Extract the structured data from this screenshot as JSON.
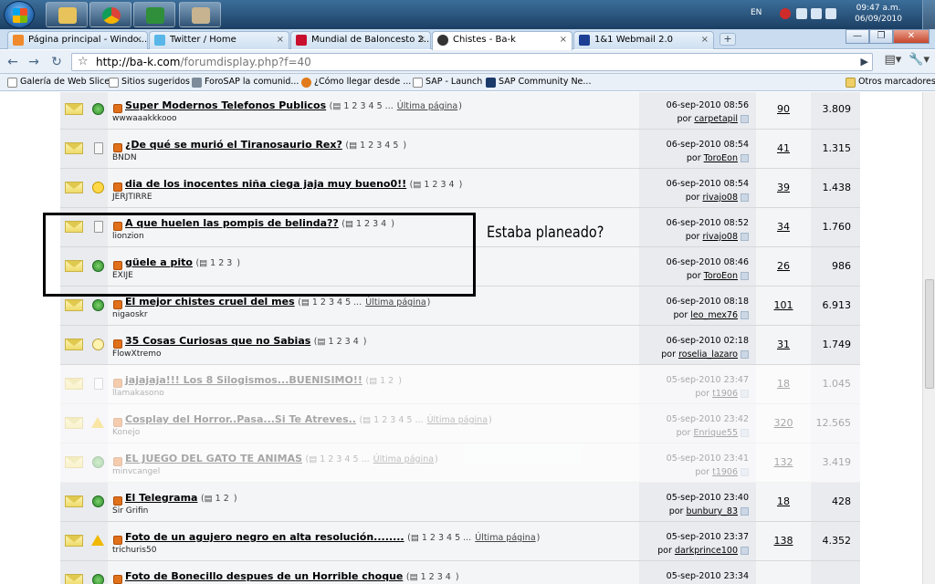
{
  "taskbar": {
    "lang": "EN",
    "time": "09:47 a.m.",
    "date": "06/09/2010"
  },
  "tabs": [
    {
      "label": "Página principal - Windo..."
    },
    {
      "label": "Twitter / Home"
    },
    {
      "label": "Mundial de Baloncesto 2..."
    },
    {
      "label": "Chistes - Ba-k"
    },
    {
      "label": "1&1 Webmail 2.0"
    }
  ],
  "new_tab": "+",
  "window_buttons": {
    "min": "—",
    "max": "❐",
    "close": "✕"
  },
  "address": {
    "host": "http://ba-k.com",
    "path": "/forumdisplay.php?f=40"
  },
  "bookmarks": [
    {
      "label": "Galería de Web Slice"
    },
    {
      "label": "Sitios sugeridos"
    },
    {
      "label": "ForoSAP la comunid..."
    },
    {
      "label": "¿Cómo llegar desde ..."
    },
    {
      "label": "SAP - Launch"
    },
    {
      "label": "SAP Community Ne..."
    },
    {
      "label": "Otros marcadores"
    }
  ],
  "annotation": "Estaba planeado?",
  "threads": [
    {
      "title": "Super Modernos Telefonos Publicos",
      "pages": "1 2 3 4 5 ...",
      "last": "Última página",
      "author": "wwwaaakkkooo",
      "date": "06-sep-2010 08:56",
      "by": "carpetapil",
      "replies": "90",
      "views": "3.809",
      "icon": "globe"
    },
    {
      "title": "¿De qué se murió el Tiranosaurio Rex?",
      "pages": "1 2 3 4 5",
      "last": "",
      "author": "BNDN",
      "date": "06-sep-2010 08:54",
      "by": "ToroEon",
      "replies": "41",
      "views": "1.315",
      "icon": "doc"
    },
    {
      "title": "dia de los inocentes niña ciega jaja muy bueno0!!",
      "pages": "1 2 3 4",
      "last": "",
      "author": "JERJTIRRE",
      "date": "06-sep-2010 08:54",
      "by": "rivajo08",
      "replies": "39",
      "views": "1.438",
      "icon": "smile"
    },
    {
      "title": "A que huelen las pompis de belinda??",
      "pages": "1 2 3 4",
      "last": "",
      "author": "lionzion",
      "date": "06-sep-2010 08:52",
      "by": "rivajo08",
      "replies": "34",
      "views": "1.760",
      "icon": "doc"
    },
    {
      "title": "güele a pito",
      "pages": "1 2 3",
      "last": "",
      "author": "EXIJE",
      "date": "06-sep-2010 08:46",
      "by": "ToroEon",
      "replies": "26",
      "views": "986",
      "icon": "globe"
    },
    {
      "title": "El mejor chistes cruel del mes",
      "pages": "1 2 3 4 5 ...",
      "last": "Última página",
      "author": "nigaoskr",
      "date": "06-sep-2010 08:18",
      "by": "leo_mex76",
      "replies": "101",
      "views": "6.913",
      "icon": "globe"
    },
    {
      "title": "35 Cosas Curiosas que no Sabias",
      "pages": "1 2 3 4",
      "last": "",
      "author": "FlowXtremo",
      "date": "06-sep-2010 02:18",
      "by": "roselia_lazaro",
      "replies": "31",
      "views": "1.749",
      "icon": "bulb"
    },
    {
      "title": "jajajaja!!! Los 8 Silogismos...BUENISIMO!!",
      "pages": "1 2",
      "last": "",
      "author": "llamakasono",
      "date": "05-sep-2010 23:47",
      "by": "t1906",
      "replies": "18",
      "views": "1.045",
      "icon": "doc"
    },
    {
      "title": "Cosplay del Horror..Pasa...Si Te Atreves..",
      "pages": "1 2 3 4 5 ...",
      "last": "Última página",
      "author": "Konejo",
      "date": "05-sep-2010 23:42",
      "by": "Enrique55",
      "replies": "320",
      "views": "12.565",
      "icon": "warn"
    },
    {
      "title": "EL JUEGO DEL GATO TE ANIMAS",
      "pages": "1 2 3 4 5 ...",
      "last": "Última página",
      "author": "minvcangel",
      "date": "05-sep-2010 23:41",
      "by": "t1906",
      "replies": "132",
      "views": "3.419",
      "icon": "globe"
    },
    {
      "title": "El Telegrama",
      "pages": "1 2",
      "last": "",
      "author": "Sir Grifin",
      "date": "05-sep-2010 23:40",
      "by": "bunbury_83",
      "replies": "18",
      "views": "428",
      "icon": "globe"
    },
    {
      "title": "Foto de un agujero negro en alta resolución........",
      "pages": "1 2 3 4 5 ...",
      "last": "Última página",
      "author": "trichuris50",
      "date": "05-sep-2010 23:37",
      "by": "darkprince100",
      "replies": "138",
      "views": "4.352",
      "icon": "warn"
    },
    {
      "title": "Foto de Bonecillo despues de un Horrible choque",
      "pages": "1 2 3 4",
      "last": "",
      "author": "",
      "date": "05-sep-2010 23:34",
      "by": "",
      "replies": "",
      "views": "",
      "icon": "globe"
    }
  ],
  "colors": {
    "accent": "#e0701a",
    "tab_bar": "#c9dcf0",
    "row_dark": "#e9ebef",
    "row_light": "#f4f5f7"
  }
}
